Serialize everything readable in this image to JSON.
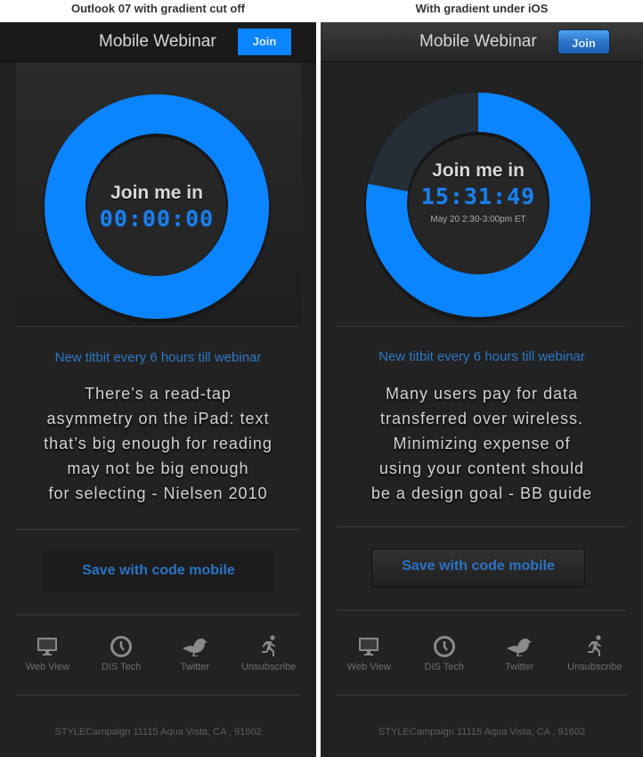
{
  "captions": {
    "left": "Outlook 07 with gradient cut off",
    "right": "With gradient under iOS"
  },
  "colors": {
    "accent_blue": "#0a84ff",
    "ring_remaining": "#252d36",
    "link_blue": "#2c78c8",
    "background": "#222222"
  },
  "panels": {
    "left": {
      "header": {
        "title": "Mobile Webinar",
        "join_label": "Join"
      },
      "countdown": {
        "title": "Join me in",
        "timer": "00:00:00",
        "date": "",
        "progress_fraction": 1.0
      },
      "titbit_heading": "New titbit every 6 hours till webinar",
      "quote_lines": [
        "There’s a read-tap",
        "asymmetry on the iPad: text",
        "that’s big enough for reading",
        "may not be big enough",
        "for selecting - Nielsen 2010"
      ],
      "save_label": "Save with code mobile",
      "nav": [
        {
          "label": "Web View",
          "icon": "monitor-icon"
        },
        {
          "label": "DIS Tech",
          "icon": "clock-icon"
        },
        {
          "label": "Twitter",
          "icon": "bird-icon"
        },
        {
          "label": "Unsubscribe",
          "icon": "running-man-icon"
        }
      ],
      "address": "STYLECampaign 11115 Aqua Vista, CA , 91602"
    },
    "right": {
      "header": {
        "title": "Mobile Webinar",
        "join_label": "Join"
      },
      "countdown": {
        "title": "Join me in",
        "timer": "15:31:49",
        "date": "May 20 2:30-3:00pm ET",
        "progress_fraction": 0.78
      },
      "titbit_heading": "New titbit every 6 hours till webinar",
      "quote_lines": [
        "Many users pay for data",
        "transferred over wireless.",
        "Minimizing expense of",
        "using your content should",
        "be a design goal - BB guide"
      ],
      "save_label": "Save with code mobile",
      "nav": [
        {
          "label": "Web View",
          "icon": "monitor-icon"
        },
        {
          "label": "DIS Tech",
          "icon": "clock-icon"
        },
        {
          "label": "Twitter",
          "icon": "bird-icon"
        },
        {
          "label": "Unsubscribe",
          "icon": "running-man-icon"
        }
      ],
      "address": "STYLECampaign 11115 Aqua Vista, CA , 91602"
    }
  }
}
